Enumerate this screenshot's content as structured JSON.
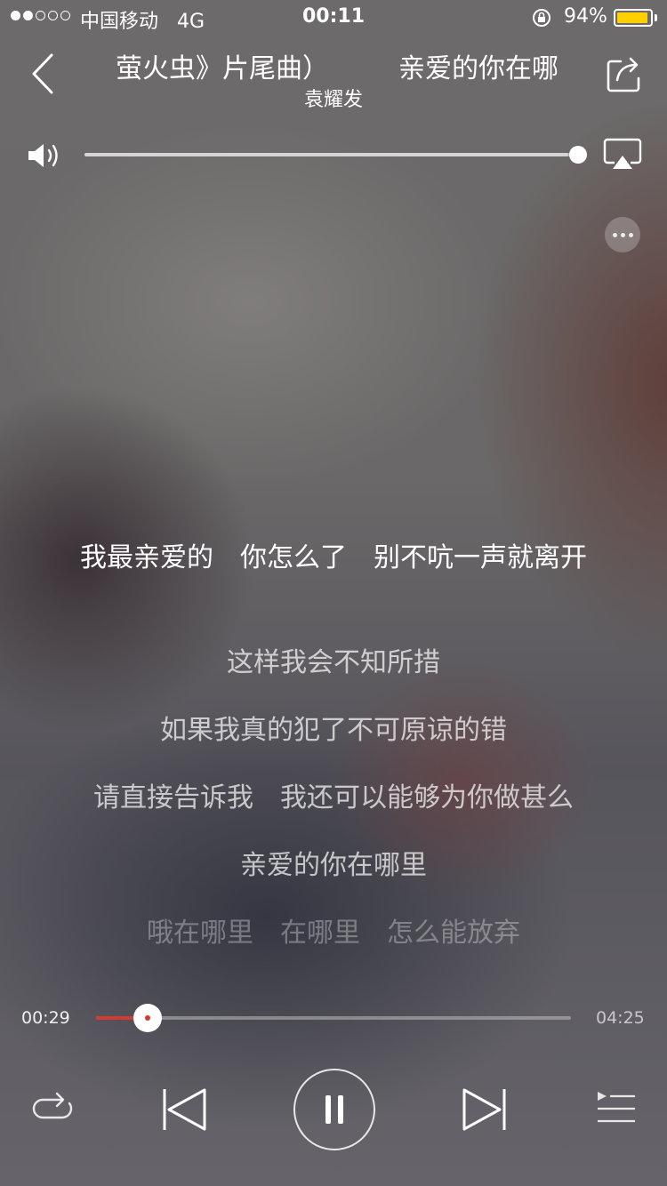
{
  "status_bar": {
    "carrier": "中国移动",
    "network": "4G",
    "time": "00:11",
    "battery_percent": "94%",
    "battery_level": 0.94,
    "battery_color": "#ffcf00"
  },
  "header": {
    "title_scroll": [
      "萤火虫》片尾曲）",
      "亲爱的你在哪"
    ],
    "artist": "袁耀发"
  },
  "volume": {
    "level": 0.98
  },
  "lyrics": [
    {
      "text": "我最亲爱的　你怎么了　别不吭一声就离开",
      "state": "current",
      "opacity": 1.0
    },
    {
      "text": "这样我会不知所措",
      "state": "next",
      "opacity": 0.7
    },
    {
      "text": "如果我真的犯了不可原谅的错",
      "state": "next",
      "opacity": 0.7
    },
    {
      "text": "请直接告诉我　我还可以能够为你做甚么",
      "state": "next",
      "opacity": 0.7
    },
    {
      "text": "亲爱的你在哪里",
      "state": "next",
      "opacity": 0.7
    },
    {
      "text": "哦在哪里　在哪里　怎么能放弃",
      "state": "next",
      "opacity": 0.32
    }
  ],
  "progress": {
    "current_time": "00:29",
    "total_time": "04:25",
    "fraction": 0.109,
    "accent_color": "#d33a31"
  },
  "controls": {
    "repeat_icon": "repeat-icon",
    "previous_icon": "previous-track-icon",
    "play_state_icon": "pause-icon",
    "next_icon": "next-track-icon",
    "playlist_icon": "playlist-icon"
  }
}
